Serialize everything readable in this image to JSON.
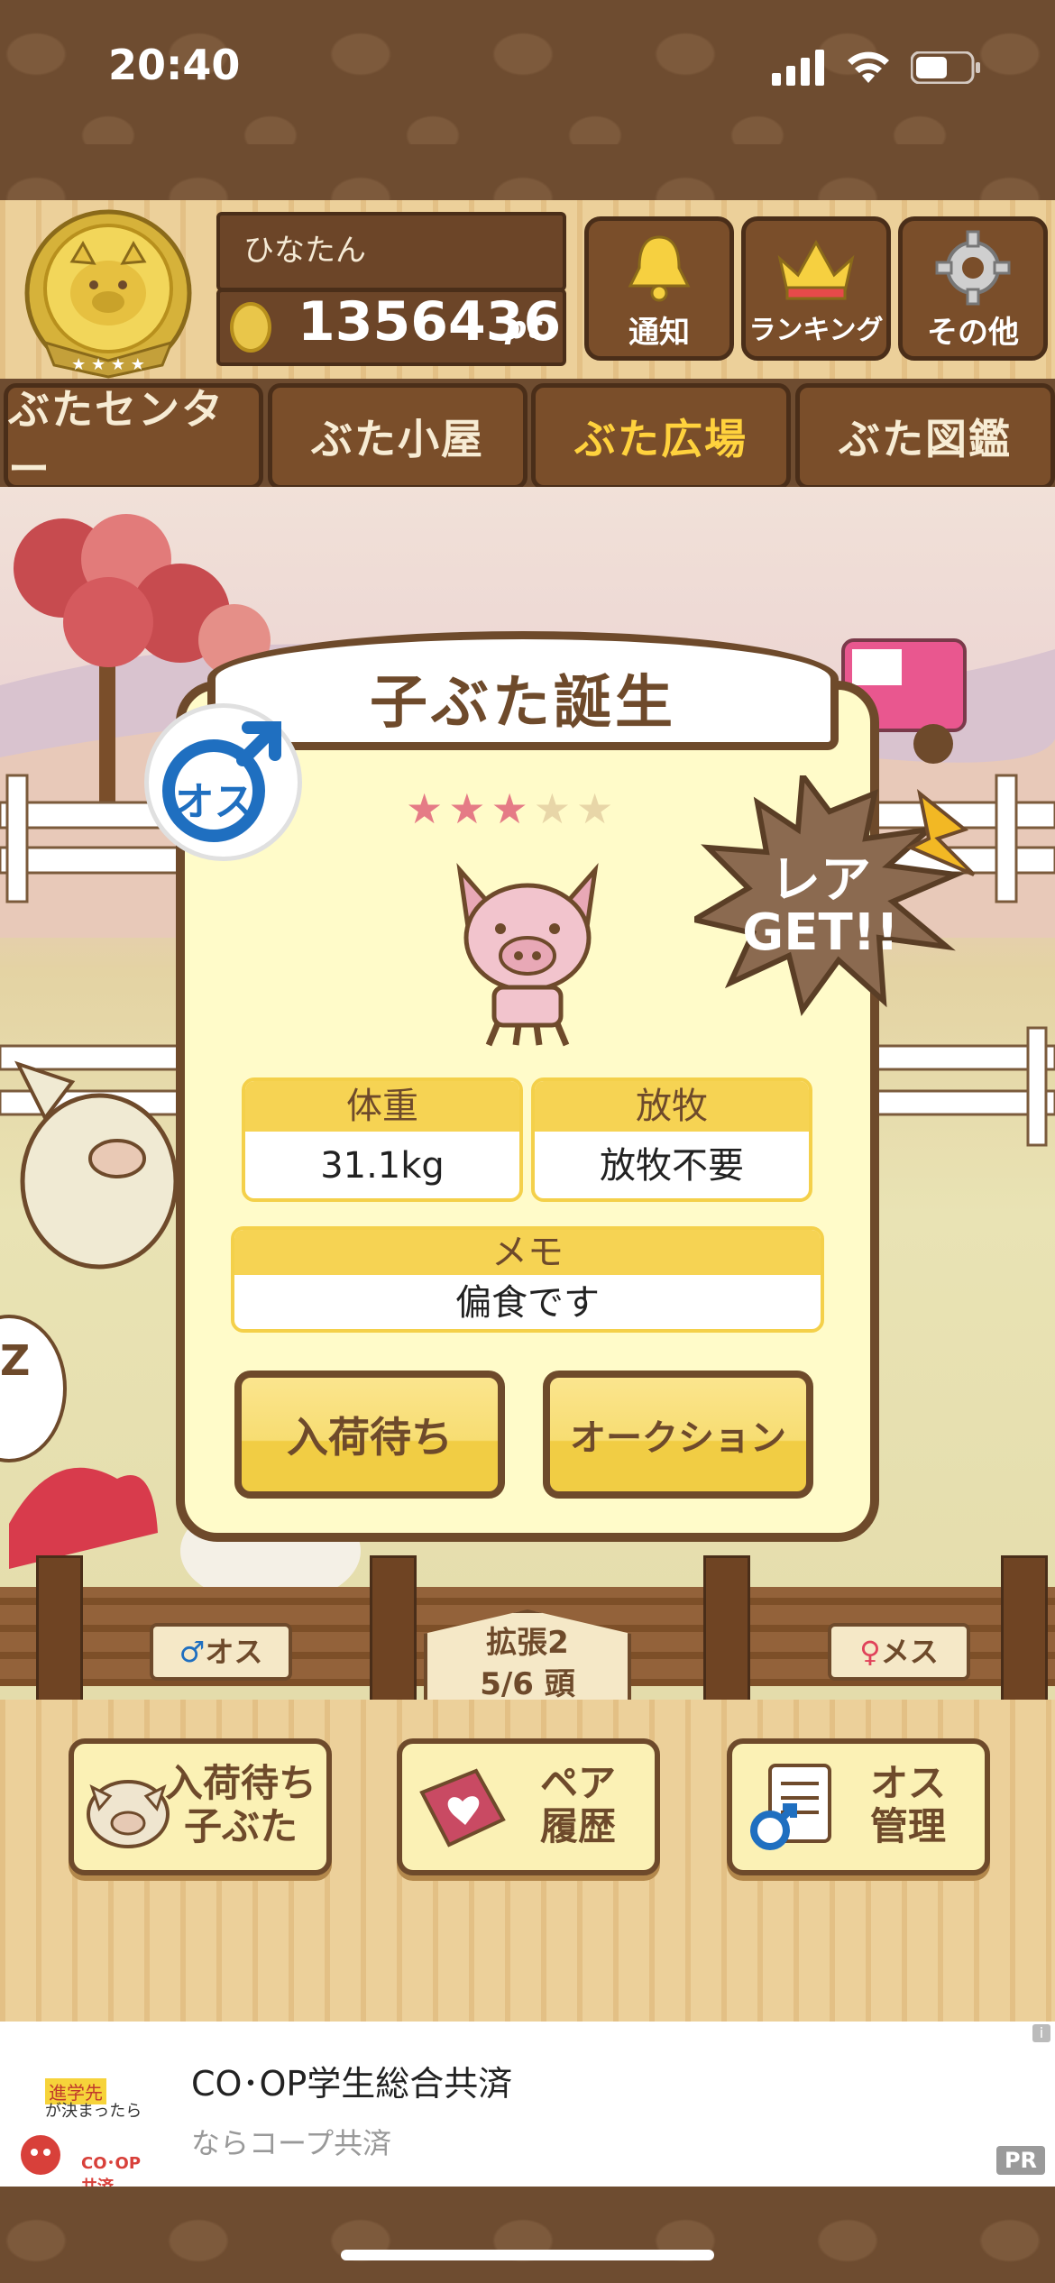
{
  "status_bar": {
    "time": "20:40"
  },
  "header": {
    "user_name": "ひなたん",
    "points": "1356436",
    "points_unit": "pt",
    "buttons": {
      "notify": "通知",
      "ranking": "ランキング",
      "other": "その他"
    }
  },
  "tabs": [
    {
      "label": "ぶたセンター",
      "active": false
    },
    {
      "label": "ぶた小屋",
      "active": false
    },
    {
      "label": "ぶた広場",
      "active": true
    },
    {
      "label": "ぶた図鑑",
      "active": false
    }
  ],
  "dialog": {
    "title": "子ぶた誕生",
    "gender_badge": "オス",
    "rating": {
      "filled": 3,
      "total": 5
    },
    "rare_badge": [
      "レア",
      "GET!!"
    ],
    "weight": {
      "label": "体重",
      "value": "31.1kg"
    },
    "ranch": {
      "label": "放牧",
      "value": "放牧不要"
    },
    "memo": {
      "label": "メモ",
      "value": "偏食です"
    },
    "primary_button": "入荷待ち",
    "secondary_button": "オークション"
  },
  "scene": {
    "sign_male": "オス",
    "sign_female": "メス",
    "sign_expand_line1": "拡張2",
    "sign_expand_line2": "5/6 頭"
  },
  "bottom_menu": [
    {
      "line1": "入荷待ち",
      "line2": "子ぶた"
    },
    {
      "line1": "ペア",
      "line2": "履歴"
    },
    {
      "line1": "オス",
      "line2": "管理"
    }
  ],
  "ad": {
    "title": "CO･OP学生総合共済",
    "subtitle": "ならコープ共済",
    "logo_text": "CO･OP共済",
    "tagline_highlight": "進学先",
    "tagline_rest": "が決まったら",
    "pr_label": "PR",
    "info_icon": "i"
  },
  "colors": {
    "wood_dark": "#6e4a2b",
    "accent_yellow": "#f6d353",
    "active_tab": "#ffd23d",
    "star_on": "#e57b86",
    "male_blue": "#1f6fc0"
  }
}
